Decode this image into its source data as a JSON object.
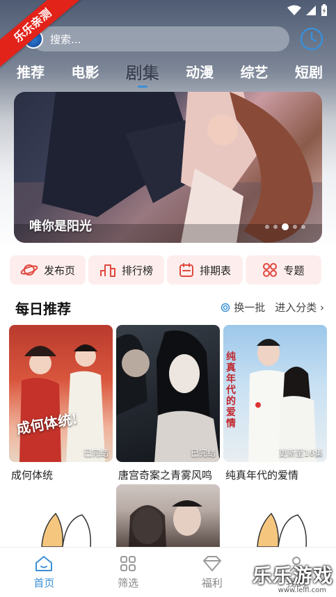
{
  "search": {
    "placeholder": "搜索..."
  },
  "ribbon": "乐乐亲测",
  "category_tabs": [
    {
      "label": "推荐"
    },
    {
      "label": "电影"
    },
    {
      "label": "剧集"
    },
    {
      "label": "动漫"
    },
    {
      "label": "综艺"
    },
    {
      "label": "短剧"
    }
  ],
  "active_tab": "剧集",
  "banner": {
    "title": "唯你是阳光",
    "page_count": 5,
    "active_page": 3
  },
  "quick_links": [
    {
      "label": "发布页",
      "icon": "planet-icon"
    },
    {
      "label": "排行榜",
      "icon": "podium-icon"
    },
    {
      "label": "排期表",
      "icon": "calendar-icon"
    },
    {
      "label": "专题",
      "icon": "grid-circles-icon"
    }
  ],
  "section": {
    "title": "每日推荐",
    "refresh_label": "换一批",
    "more_label": "进入分类"
  },
  "cards": [
    {
      "title": "成何体统",
      "badge": "已完结",
      "poster_text": "成何体统!"
    },
    {
      "title": "唐宫奇案之青雾风鸣",
      "badge": "已完结"
    },
    {
      "title": "纯真年代的爱情",
      "badge": "更新至16集",
      "poster_text": "纯真年代的爱情"
    }
  ],
  "bottom_nav": [
    {
      "label": "首页"
    },
    {
      "label": "筛选"
    },
    {
      "label": "福利"
    },
    {
      "label": "我的"
    }
  ],
  "watermark": "乐乐游戏",
  "watermark_url": "www.lelfl.com",
  "colors": {
    "accent": "#3a8fd6",
    "ribbon": "#e2231a",
    "quick_bg": "#fdeeed",
    "quick_icon": "#e0483f"
  }
}
